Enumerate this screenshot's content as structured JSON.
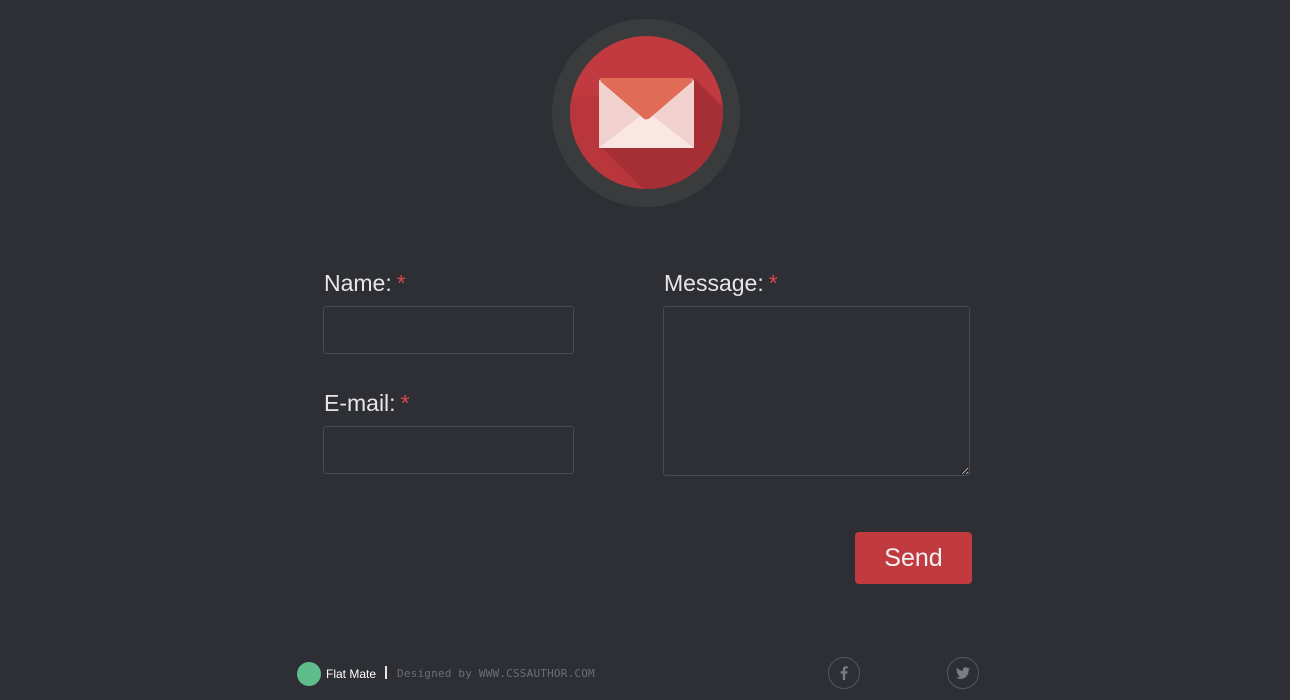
{
  "header": {
    "logo_icon": "envelope-icon"
  },
  "form": {
    "name": {
      "label": "Name:",
      "required_mark": "*",
      "value": ""
    },
    "email": {
      "label": "E-mail:",
      "required_mark": "*",
      "value": ""
    },
    "message": {
      "label": "Message:",
      "required_mark": "*",
      "value": ""
    },
    "send_label": "Send"
  },
  "footer": {
    "brand": "Flat Mate",
    "credit": "Designed by WWW.CSSAUTHOR.COM",
    "social": [
      {
        "name": "facebook",
        "icon": "facebook-icon"
      },
      {
        "name": "twitter",
        "icon": "twitter-icon"
      }
    ]
  },
  "colors": {
    "background": "#2d2f34",
    "accent": "#c03a40",
    "brand_dot": "#5fbd8c",
    "required": "#d9474b"
  }
}
